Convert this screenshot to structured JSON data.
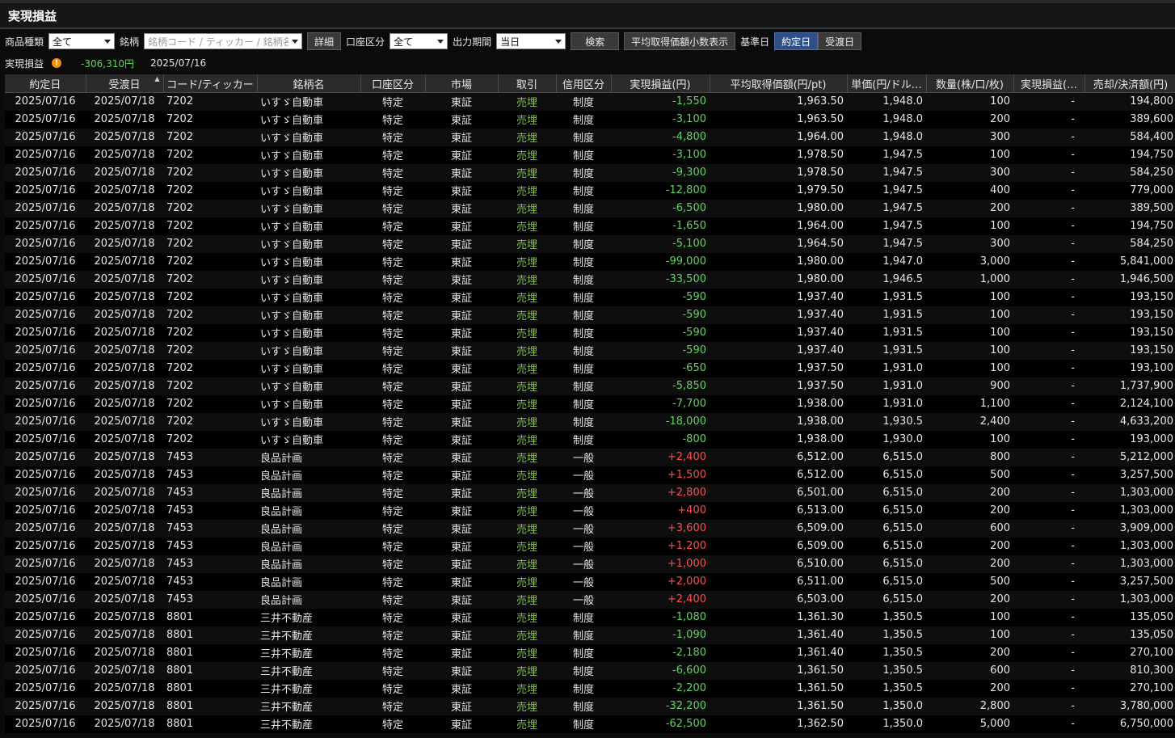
{
  "window": {
    "title": "実現損益"
  },
  "filters": {
    "product_type_label": "商品種類",
    "product_type_value": "全て",
    "symbol_label": "銘柄",
    "symbol_placeholder": "銘柄コード / ティッカー / 銘柄名",
    "detail_button": "詳細",
    "account_label": "口座区分",
    "account_value": "全て",
    "period_label": "出力期間",
    "period_value": "当日",
    "search_button": "検索",
    "avg_price_button": "平均取得価額小数表示",
    "base_date_label": "基準日",
    "trade_date_button": "約定日",
    "delivery_date_button": "受渡日"
  },
  "summary": {
    "label": "実現損益",
    "warning_icon": "!",
    "total": "-306,310円",
    "date": "2025/07/16"
  },
  "table": {
    "columns": [
      "約定日",
      "受渡日",
      "コード/ティッカー",
      "銘柄名",
      "口座区分",
      "市場",
      "取引",
      "信用区分",
      "実現損益(円)",
      "平均取得価額(円/pt)",
      "単価(円/ドル…",
      "数量(株/口/枚)",
      "実現損益(…",
      "売却/決済額(円)",
      "売"
    ],
    "rows": [
      [
        "2025/07/16",
        "2025/07/18",
        "7202",
        "いすゞ自動車",
        "特定",
        "東証",
        "売埋",
        "制度",
        "-1,550",
        "1,963.50",
        "1,948.0",
        "100",
        "-",
        "194,800"
      ],
      [
        "2025/07/16",
        "2025/07/18",
        "7202",
        "いすゞ自動車",
        "特定",
        "東証",
        "売埋",
        "制度",
        "-3,100",
        "1,963.50",
        "1,948.0",
        "200",
        "-",
        "389,600"
      ],
      [
        "2025/07/16",
        "2025/07/18",
        "7202",
        "いすゞ自動車",
        "特定",
        "東証",
        "売埋",
        "制度",
        "-4,800",
        "1,964.00",
        "1,948.0",
        "300",
        "-",
        "584,400"
      ],
      [
        "2025/07/16",
        "2025/07/18",
        "7202",
        "いすゞ自動車",
        "特定",
        "東証",
        "売埋",
        "制度",
        "-3,100",
        "1,978.50",
        "1,947.5",
        "100",
        "-",
        "194,750"
      ],
      [
        "2025/07/16",
        "2025/07/18",
        "7202",
        "いすゞ自動車",
        "特定",
        "東証",
        "売埋",
        "制度",
        "-9,300",
        "1,978.50",
        "1,947.5",
        "300",
        "-",
        "584,250"
      ],
      [
        "2025/07/16",
        "2025/07/18",
        "7202",
        "いすゞ自動車",
        "特定",
        "東証",
        "売埋",
        "制度",
        "-12,800",
        "1,979.50",
        "1,947.5",
        "400",
        "-",
        "779,000"
      ],
      [
        "2025/07/16",
        "2025/07/18",
        "7202",
        "いすゞ自動車",
        "特定",
        "東証",
        "売埋",
        "制度",
        "-6,500",
        "1,980.00",
        "1,947.5",
        "200",
        "-",
        "389,500"
      ],
      [
        "2025/07/16",
        "2025/07/18",
        "7202",
        "いすゞ自動車",
        "特定",
        "東証",
        "売埋",
        "制度",
        "-1,650",
        "1,964.00",
        "1,947.5",
        "100",
        "-",
        "194,750"
      ],
      [
        "2025/07/16",
        "2025/07/18",
        "7202",
        "いすゞ自動車",
        "特定",
        "東証",
        "売埋",
        "制度",
        "-5,100",
        "1,964.50",
        "1,947.5",
        "300",
        "-",
        "584,250"
      ],
      [
        "2025/07/16",
        "2025/07/18",
        "7202",
        "いすゞ自動車",
        "特定",
        "東証",
        "売埋",
        "制度",
        "-99,000",
        "1,980.00",
        "1,947.0",
        "3,000",
        "-",
        "5,841,000"
      ],
      [
        "2025/07/16",
        "2025/07/18",
        "7202",
        "いすゞ自動車",
        "特定",
        "東証",
        "売埋",
        "制度",
        "-33,500",
        "1,980.00",
        "1,946.5",
        "1,000",
        "-",
        "1,946,500"
      ],
      [
        "2025/07/16",
        "2025/07/18",
        "7202",
        "いすゞ自動車",
        "特定",
        "東証",
        "売埋",
        "制度",
        "-590",
        "1,937.40",
        "1,931.5",
        "100",
        "-",
        "193,150"
      ],
      [
        "2025/07/16",
        "2025/07/18",
        "7202",
        "いすゞ自動車",
        "特定",
        "東証",
        "売埋",
        "制度",
        "-590",
        "1,937.40",
        "1,931.5",
        "100",
        "-",
        "193,150"
      ],
      [
        "2025/07/16",
        "2025/07/18",
        "7202",
        "いすゞ自動車",
        "特定",
        "東証",
        "売埋",
        "制度",
        "-590",
        "1,937.40",
        "1,931.5",
        "100",
        "-",
        "193,150"
      ],
      [
        "2025/07/16",
        "2025/07/18",
        "7202",
        "いすゞ自動車",
        "特定",
        "東証",
        "売埋",
        "制度",
        "-590",
        "1,937.40",
        "1,931.5",
        "100",
        "-",
        "193,150"
      ],
      [
        "2025/07/16",
        "2025/07/18",
        "7202",
        "いすゞ自動車",
        "特定",
        "東証",
        "売埋",
        "制度",
        "-650",
        "1,937.50",
        "1,931.0",
        "100",
        "-",
        "193,100"
      ],
      [
        "2025/07/16",
        "2025/07/18",
        "7202",
        "いすゞ自動車",
        "特定",
        "東証",
        "売埋",
        "制度",
        "-5,850",
        "1,937.50",
        "1,931.0",
        "900",
        "-",
        "1,737,900"
      ],
      [
        "2025/07/16",
        "2025/07/18",
        "7202",
        "いすゞ自動車",
        "特定",
        "東証",
        "売埋",
        "制度",
        "-7,700",
        "1,938.00",
        "1,931.0",
        "1,100",
        "-",
        "2,124,100"
      ],
      [
        "2025/07/16",
        "2025/07/18",
        "7202",
        "いすゞ自動車",
        "特定",
        "東証",
        "売埋",
        "制度",
        "-18,000",
        "1,938.00",
        "1,930.5",
        "2,400",
        "-",
        "4,633,200"
      ],
      [
        "2025/07/16",
        "2025/07/18",
        "7202",
        "いすゞ自動車",
        "特定",
        "東証",
        "売埋",
        "制度",
        "-800",
        "1,938.00",
        "1,930.0",
        "100",
        "-",
        "193,000"
      ],
      [
        "2025/07/16",
        "2025/07/18",
        "7453",
        "良品計画",
        "特定",
        "東証",
        "売埋",
        "一般",
        "+2,400",
        "6,512.00",
        "6,515.0",
        "800",
        "-",
        "5,212,000"
      ],
      [
        "2025/07/16",
        "2025/07/18",
        "7453",
        "良品計画",
        "特定",
        "東証",
        "売埋",
        "一般",
        "+1,500",
        "6,512.00",
        "6,515.0",
        "500",
        "-",
        "3,257,500"
      ],
      [
        "2025/07/16",
        "2025/07/18",
        "7453",
        "良品計画",
        "特定",
        "東証",
        "売埋",
        "一般",
        "+2,800",
        "6,501.00",
        "6,515.0",
        "200",
        "-",
        "1,303,000"
      ],
      [
        "2025/07/16",
        "2025/07/18",
        "7453",
        "良品計画",
        "特定",
        "東証",
        "売埋",
        "一般",
        "+400",
        "6,513.00",
        "6,515.0",
        "200",
        "-",
        "1,303,000"
      ],
      [
        "2025/07/16",
        "2025/07/18",
        "7453",
        "良品計画",
        "特定",
        "東証",
        "売埋",
        "一般",
        "+3,600",
        "6,509.00",
        "6,515.0",
        "600",
        "-",
        "3,909,000"
      ],
      [
        "2025/07/16",
        "2025/07/18",
        "7453",
        "良品計画",
        "特定",
        "東証",
        "売埋",
        "一般",
        "+1,200",
        "6,509.00",
        "6,515.0",
        "200",
        "-",
        "1,303,000"
      ],
      [
        "2025/07/16",
        "2025/07/18",
        "7453",
        "良品計画",
        "特定",
        "東証",
        "売埋",
        "一般",
        "+1,000",
        "6,510.00",
        "6,515.0",
        "200",
        "-",
        "1,303,000"
      ],
      [
        "2025/07/16",
        "2025/07/18",
        "7453",
        "良品計画",
        "特定",
        "東証",
        "売埋",
        "一般",
        "+2,000",
        "6,511.00",
        "6,515.0",
        "500",
        "-",
        "3,257,500"
      ],
      [
        "2025/07/16",
        "2025/07/18",
        "7453",
        "良品計画",
        "特定",
        "東証",
        "売埋",
        "一般",
        "+2,400",
        "6,503.00",
        "6,515.0",
        "200",
        "-",
        "1,303,000"
      ],
      [
        "2025/07/16",
        "2025/07/18",
        "8801",
        "三井不動産",
        "特定",
        "東証",
        "売埋",
        "制度",
        "-1,080",
        "1,361.30",
        "1,350.5",
        "100",
        "-",
        "135,050"
      ],
      [
        "2025/07/16",
        "2025/07/18",
        "8801",
        "三井不動産",
        "特定",
        "東証",
        "売埋",
        "制度",
        "-1,090",
        "1,361.40",
        "1,350.5",
        "100",
        "-",
        "135,050"
      ],
      [
        "2025/07/16",
        "2025/07/18",
        "8801",
        "三井不動産",
        "特定",
        "東証",
        "売埋",
        "制度",
        "-2,180",
        "1,361.40",
        "1,350.5",
        "200",
        "-",
        "270,100"
      ],
      [
        "2025/07/16",
        "2025/07/18",
        "8801",
        "三井不動産",
        "特定",
        "東証",
        "売埋",
        "制度",
        "-6,600",
        "1,361.50",
        "1,350.5",
        "600",
        "-",
        "810,300"
      ],
      [
        "2025/07/16",
        "2025/07/18",
        "8801",
        "三井不動産",
        "特定",
        "東証",
        "売埋",
        "制度",
        "-2,200",
        "1,361.50",
        "1,350.5",
        "200",
        "-",
        "270,100"
      ],
      [
        "2025/07/16",
        "2025/07/18",
        "8801",
        "三井不動産",
        "特定",
        "東証",
        "売埋",
        "制度",
        "-32,200",
        "1,361.50",
        "1,350.0",
        "2,800",
        "-",
        "3,780,000"
      ],
      [
        "2025/07/16",
        "2025/07/18",
        "8801",
        "三井不動産",
        "特定",
        "東証",
        "売埋",
        "制度",
        "-62,500",
        "1,362.50",
        "1,350.0",
        "5,000",
        "-",
        "6,750,000"
      ]
    ]
  },
  "colors": {
    "profit": "#ff4d4d",
    "loss": "#5cd65c",
    "trade": "#7fc243"
  }
}
